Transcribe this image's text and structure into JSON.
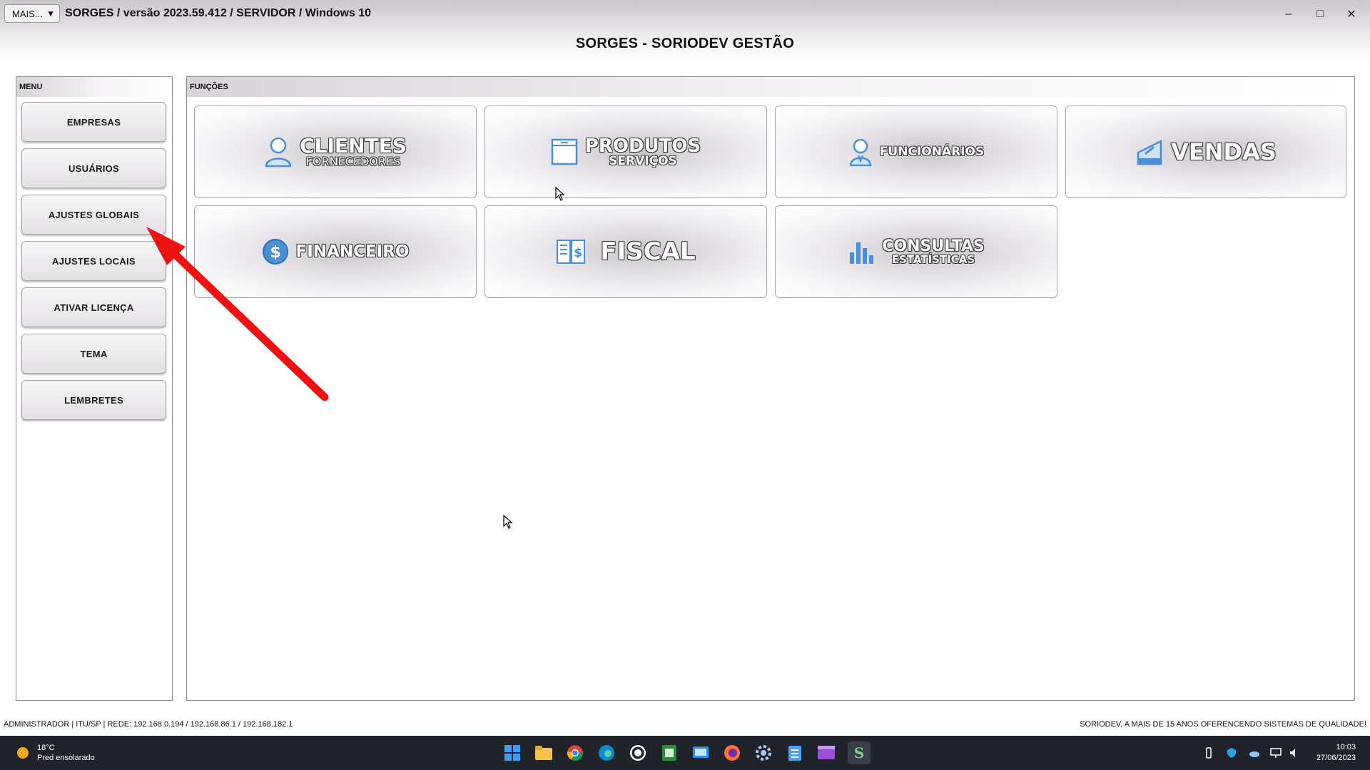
{
  "window": {
    "mais_label": "MAIS...",
    "title": "SORGES / versão 2023.59.412 / SERVIDOR / Windows 10",
    "minimize": "–",
    "maximize": "□",
    "close": "✕"
  },
  "heading": "SORGES - SORIODEV GESTÃO",
  "menu": {
    "header": "MENU",
    "items": [
      {
        "label": "EMPRESAS"
      },
      {
        "label": "USUÁRIOS"
      },
      {
        "label": "AJUSTES GLOBAIS"
      },
      {
        "label": "AJUSTES LOCAIS"
      },
      {
        "label": "ATIVAR LICENÇA"
      },
      {
        "label": "TEMA"
      },
      {
        "label": "LEMBRETES"
      }
    ]
  },
  "functions": {
    "header": "FUNÇÕES",
    "items": [
      {
        "title": "CLIENTES",
        "subtitle": "FORNECEDORES",
        "icon": "user-icon"
      },
      {
        "title": "PRODUTOS",
        "subtitle": "SERVIÇOS",
        "icon": "box-icon"
      },
      {
        "title": "FUNCIONÁRIOS",
        "subtitle": "",
        "icon": "employee-icon"
      },
      {
        "title": "VENDAS",
        "subtitle": "",
        "icon": "cash-register-icon"
      },
      {
        "title": "FINANCEIRO",
        "subtitle": "",
        "icon": "dollar-icon"
      },
      {
        "title": "FISCAL",
        "subtitle": "",
        "icon": "fiscal-book-icon"
      },
      {
        "title": "CONSULTAS",
        "subtitle": "ESTATÍSTICAS",
        "icon": "bar-chart-icon"
      }
    ]
  },
  "status": {
    "left": "ADMINISTRADOR |   ITU/SP |   REDE: 192.168.0.194 / 192.168.86.1 / 192.168.182.1",
    "right": "SORIODEV, A MAIS DE 15 ANOS OFERENCENDO SISTEMAS DE QUALIDADE!"
  },
  "taskbar": {
    "weather_temp": "18°C",
    "weather_desc": "Pred ensolarado",
    "time": "10:03",
    "date": "27/06/2023"
  },
  "colors": {
    "accent_blue": "#4a90d9",
    "arrow_red": "#ee1111",
    "taskbar_bg": "#20232a"
  }
}
